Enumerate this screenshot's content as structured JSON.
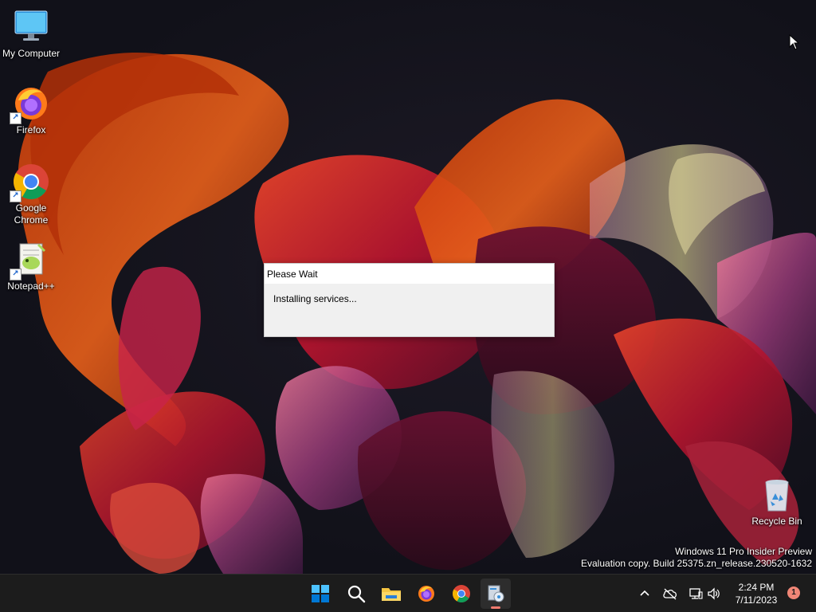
{
  "desktop_icons": [
    {
      "label": "My Computer",
      "icon": "computer-monitor-icon"
    },
    {
      "label": "Firefox",
      "icon": "firefox-icon"
    },
    {
      "label": "Google Chrome",
      "icon": "chrome-icon"
    },
    {
      "label": "Notepad++",
      "icon": "notepadpp-icon"
    },
    {
      "label": "Recycle Bin",
      "icon": "recycle-bin-icon"
    }
  ],
  "shortcut_arrow": "↗",
  "dialog": {
    "title": "Please Wait",
    "message": "Installing services..."
  },
  "watermark": {
    "line1": "Windows 11 Pro Insider Preview",
    "line2": "Evaluation copy. Build 25375.zn_release.230520-1632"
  },
  "taskbar": {
    "apps": [
      {
        "name": "Start",
        "icon": "windows-start-icon"
      },
      {
        "name": "Search",
        "icon": "search-icon"
      },
      {
        "name": "File Explorer",
        "icon": "folder-icon"
      },
      {
        "name": "Firefox",
        "icon": "firefox-icon"
      },
      {
        "name": "Google Chrome",
        "icon": "chrome-icon"
      },
      {
        "name": "Setup",
        "icon": "setup-installer-icon",
        "active": true
      }
    ],
    "tray": {
      "icons": [
        "chevron-up-icon",
        "cloud-offline-icon",
        "network-icon",
        "volume-icon"
      ],
      "time": "2:24 PM",
      "date": "7/11/2023",
      "notification_count": "1"
    }
  },
  "colors": {
    "taskbar_bg": "#1c1c1c",
    "dialog_bg": "#f0f0f0",
    "active_indicator": "#ef7a6f",
    "badge": "#f08676"
  }
}
